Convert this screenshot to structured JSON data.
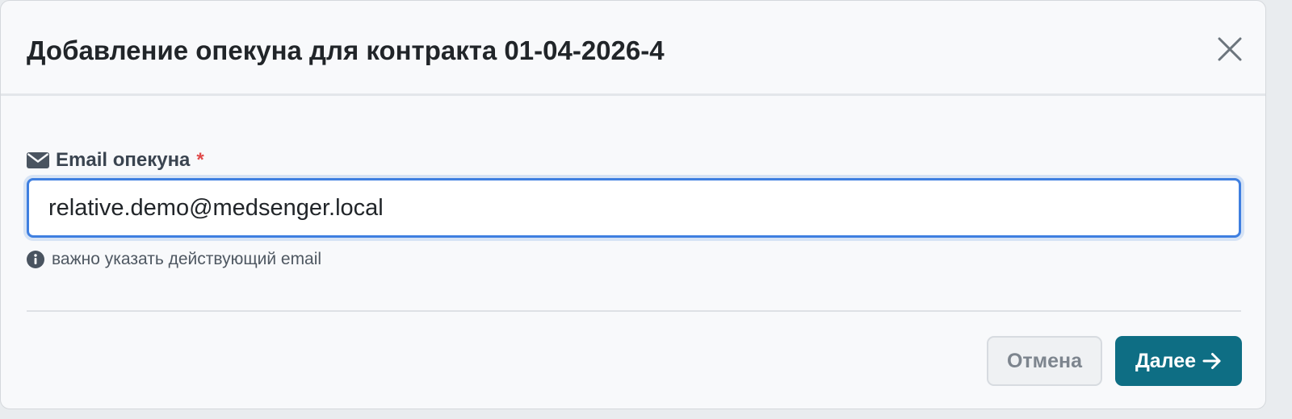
{
  "modal": {
    "title": "Добавление опекуна для контракта 01-04-2026-4",
    "close_icon": "close-icon"
  },
  "form": {
    "email_label": "Email опекуна",
    "email_label_icon": "envelope-icon",
    "required_marker": "*",
    "email_value": "relative.demo@medsenger.local",
    "hint_icon": "info-icon",
    "hint_text": "важно указать действующий email"
  },
  "footer": {
    "cancel_label": "Отмена",
    "next_label": "Далее",
    "next_icon": "arrow-right-icon"
  },
  "colors": {
    "primary": "#0e6e84",
    "input_focus_border": "#3f7fe0",
    "required": "#e04a4a",
    "modal_background": "#f8f9fb"
  }
}
